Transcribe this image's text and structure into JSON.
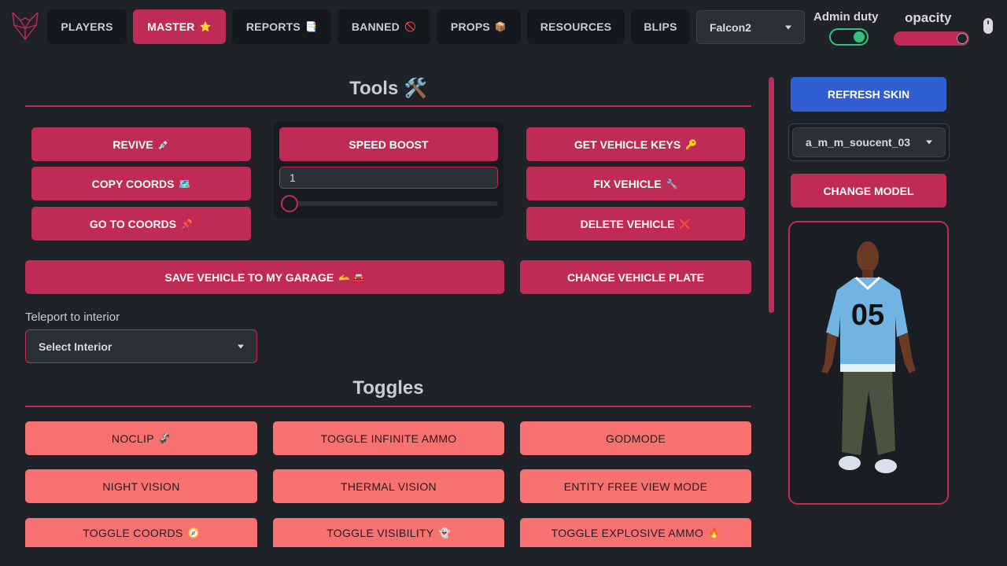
{
  "nav": {
    "tabs": [
      {
        "label": "PLAYERS",
        "emoji": ""
      },
      {
        "label": "MASTER",
        "emoji": "⭐"
      },
      {
        "label": "REPORTS",
        "emoji": "📑"
      },
      {
        "label": "BANNED",
        "emoji": "🚫"
      },
      {
        "label": "PROPS",
        "emoji": "📦"
      },
      {
        "label": "RESOURCES",
        "emoji": ""
      },
      {
        "label": "BLIPS",
        "emoji": ""
      }
    ],
    "active_tab": "MASTER",
    "player_select": "Falcon2",
    "admin_duty_label": "Admin duty",
    "admin_duty_on": true,
    "opacity_label": "opacity",
    "opacity_value": 1.0
  },
  "tools": {
    "title": "Tools 🛠️",
    "revive": {
      "label": "REVIVE",
      "emoji": "💉"
    },
    "copy_coords": {
      "label": "COPY COORDS",
      "emoji": "🗺️"
    },
    "go_to_coords": {
      "label": "GO TO COORDS",
      "emoji": "📌"
    },
    "speed_boost": {
      "label": "SPEED BOOST"
    },
    "speed_value": "1",
    "get_vehicle_keys": {
      "label": "GET VEHICLE KEYS",
      "emoji": "🔑"
    },
    "fix_vehicle": {
      "label": "FIX VEHICLE",
      "emoji": "🔧"
    },
    "delete_vehicle": {
      "label": "DELETE VEHICLE",
      "emoji": "❌"
    },
    "save_vehicle": {
      "label": "SAVE VEHICLE TO MY GARAGE",
      "emoji": "🫴 🚘"
    },
    "change_plate": {
      "label": "CHANGE VEHICLE PLATE"
    },
    "teleport_label": "Teleport to interior",
    "interior_select": "Select Interior"
  },
  "toggles": {
    "title": "Toggles",
    "items": [
      {
        "label": "NOCLIP",
        "emoji": "🦨"
      },
      {
        "label": "TOGGLE INFINITE AMMO",
        "emoji": ""
      },
      {
        "label": "GODMODE",
        "emoji": ""
      },
      {
        "label": "NIGHT VISION",
        "emoji": ""
      },
      {
        "label": "THERMAL VISION",
        "emoji": ""
      },
      {
        "label": "ENTITY FREE VIEW MODE",
        "emoji": ""
      },
      {
        "label": "TOGGLE COORDS",
        "emoji": "🧭"
      },
      {
        "label": "TOGGLE VISIBILITY",
        "emoji": "👻"
      },
      {
        "label": "TOGGLE EXPLOSIVE AMMO",
        "emoji": "🔥"
      }
    ]
  },
  "skin": {
    "refresh_label": "REFRESH SKIN",
    "model_select": "a_m_m_soucent_03",
    "change_model_label": "CHANGE MODEL",
    "jersey_number": "05"
  },
  "colors": {
    "accent": "#c02b56",
    "toggle_button": "#f87171",
    "blue_button": "#2f5fd0",
    "background": "#1f2229",
    "success": "#2fc47f"
  }
}
